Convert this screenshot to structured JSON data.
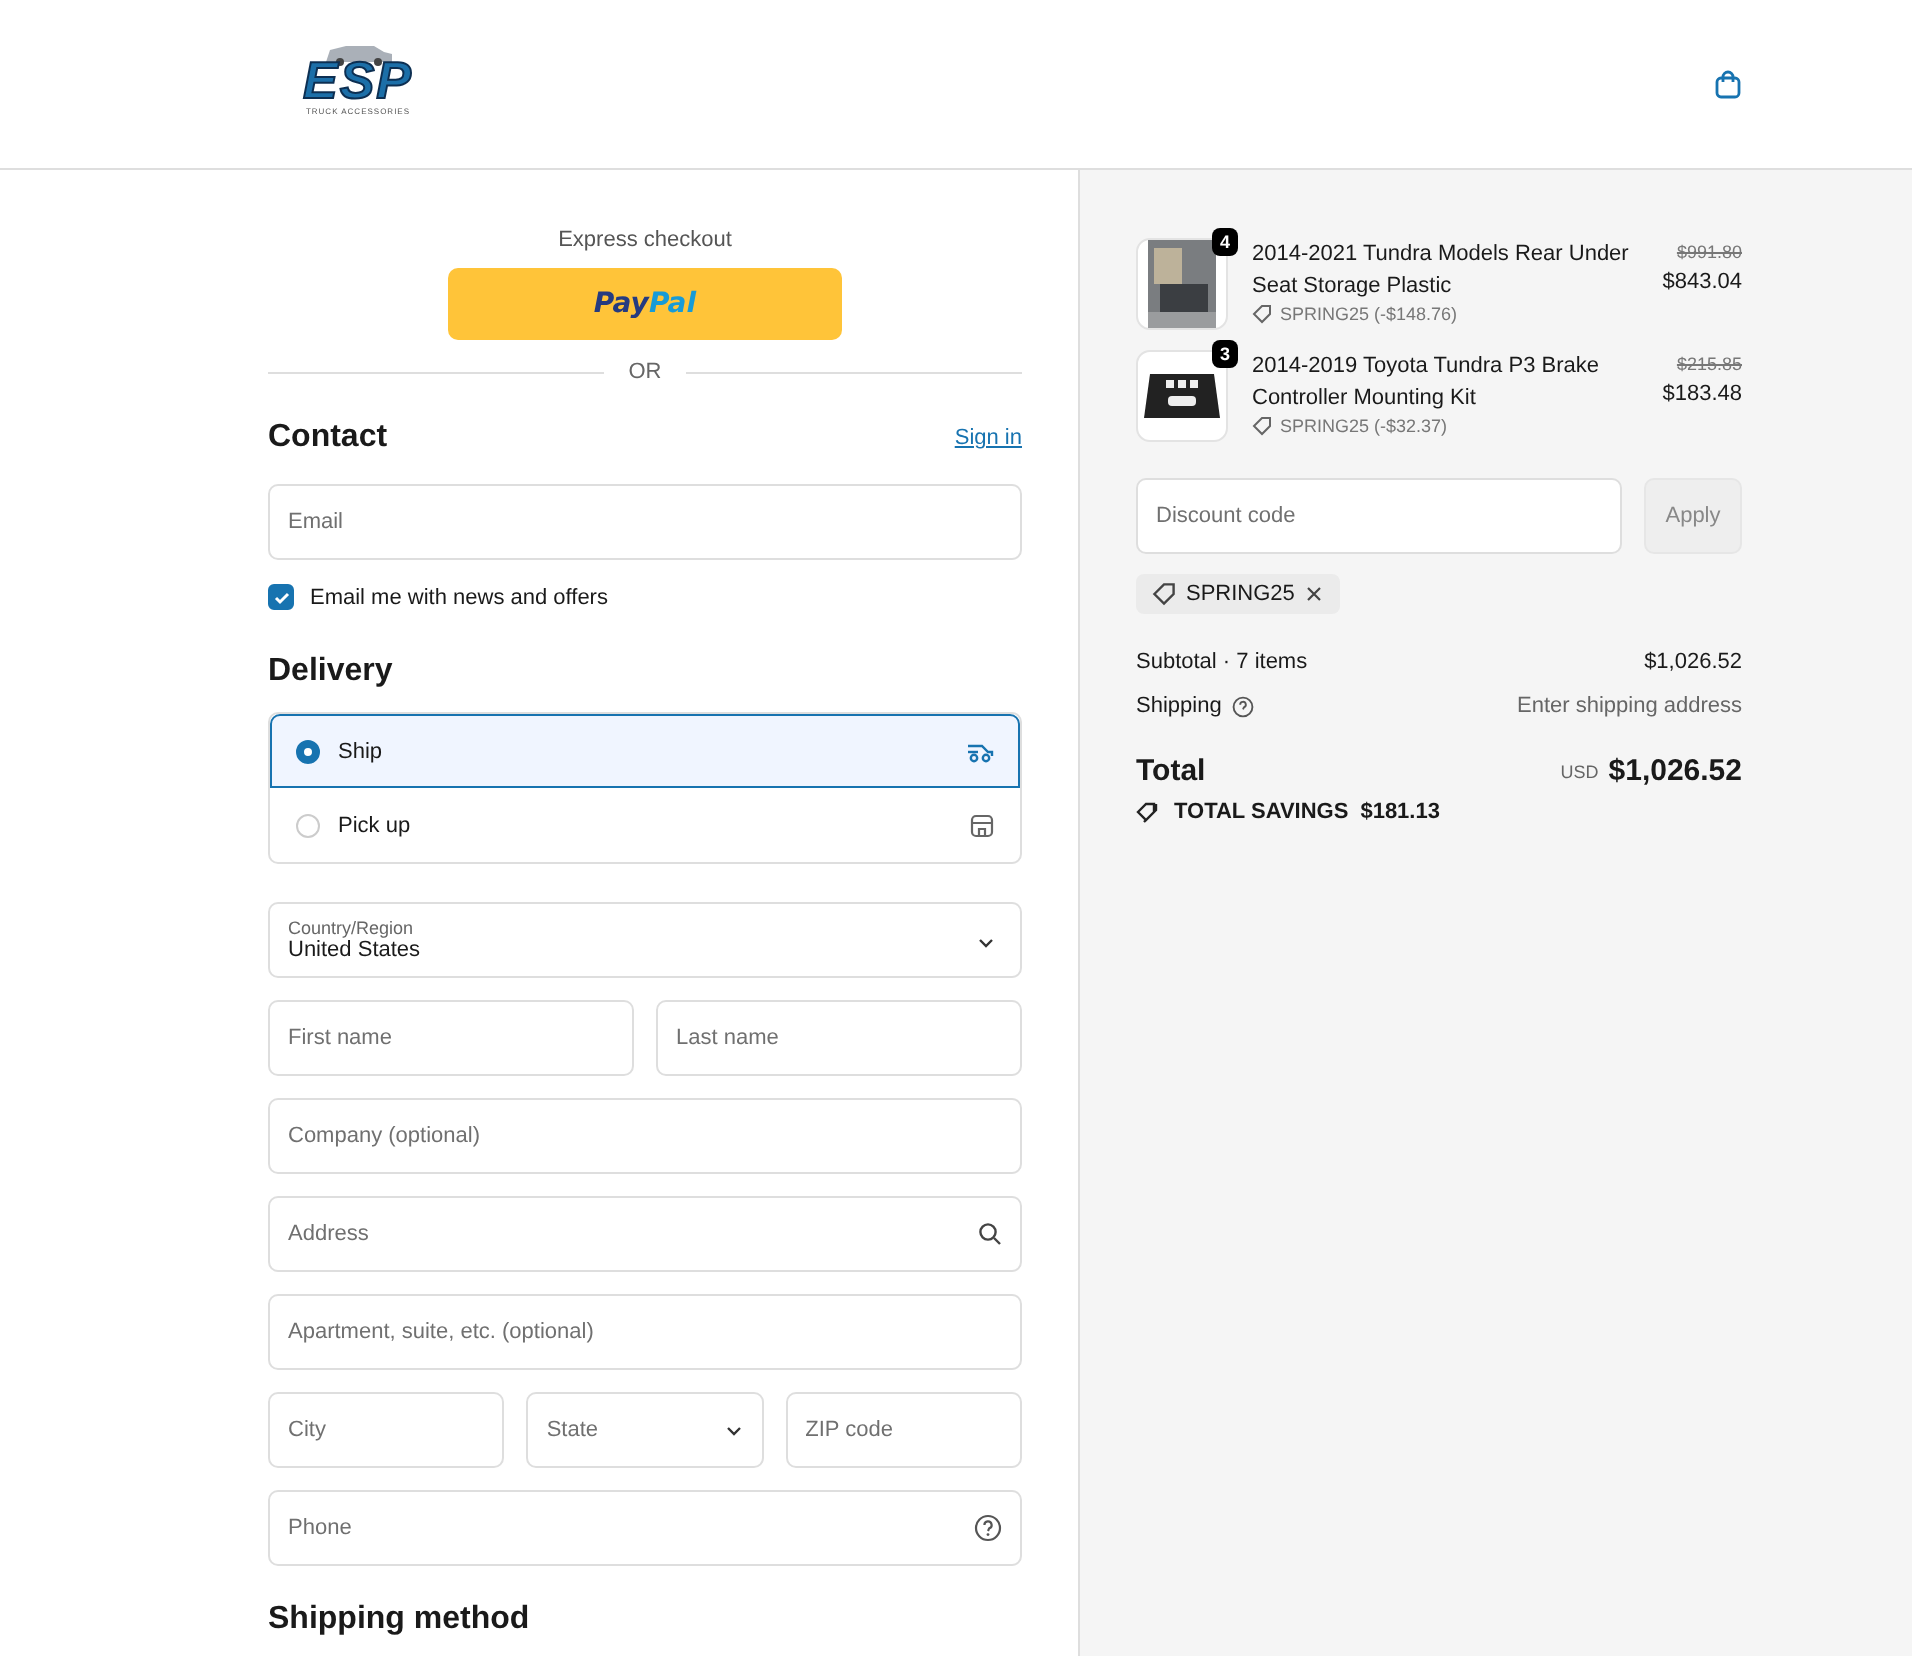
{
  "header": {
    "logo": {
      "text": "ESP",
      "subtitle": "TRUCK ACCESSORIES"
    }
  },
  "express": {
    "title": "Express checkout",
    "paypal": [
      "Pay",
      "Pal"
    ],
    "divider": "OR"
  },
  "contact": {
    "title": "Contact",
    "link": "Sign in",
    "email": {
      "placeholder": "Email"
    },
    "newsletter": {
      "label": "Email me with news and offers",
      "checked": true
    }
  },
  "delivery": {
    "title": "Delivery",
    "options": [
      {
        "label": "Ship",
        "selected": true,
        "kind": "ship"
      },
      {
        "label": "Pick up",
        "selected": false,
        "kind": "pickup"
      }
    ]
  },
  "address": {
    "country": {
      "label": "Country/Region",
      "value": "United States"
    },
    "rows": [
      [
        {
          "placeholder": "First name",
          "kind": "text"
        },
        {
          "placeholder": "Last name",
          "kind": "text"
        }
      ],
      [
        {
          "placeholder": "Company (optional)",
          "kind": "text"
        }
      ],
      [
        {
          "placeholder": "Address",
          "kind": "search"
        }
      ],
      [
        {
          "placeholder": "Apartment, suite, etc. (optional)",
          "kind": "text"
        }
      ],
      [
        {
          "placeholder": "City",
          "kind": "text"
        },
        {
          "placeholder": "State",
          "kind": "select"
        },
        {
          "placeholder": "ZIP code",
          "kind": "text"
        }
      ],
      [
        {
          "placeholder": "Phone",
          "kind": "help"
        }
      ]
    ]
  },
  "shipping_method": {
    "title": "Shipping method"
  },
  "summary": {
    "items": [
      {
        "quantity": "4",
        "name": "2014-2021 Tundra Models Rear Under Seat Storage Plastic",
        "discount": "SPRING25 (-$148.76)",
        "original_price": "$991.80",
        "price": "$843.04",
        "kind": "photo"
      },
      {
        "quantity": "3",
        "name": "2014-2019 Toyota Tundra P3 Brake Controller Mounting Kit",
        "discount": "SPRING25 (-$32.37)",
        "original_price": "$215.85",
        "price": "$183.48",
        "kind": "bracket"
      }
    ],
    "discount": {
      "placeholder": "Discount code",
      "button": "Apply"
    },
    "applied_code": "SPRING25",
    "subtotal": {
      "label": "Subtotal · 7 items",
      "value": "$1,026.52"
    },
    "shipping": {
      "label": "Shipping",
      "value": "Enter shipping address"
    },
    "total": {
      "label": "Total",
      "currency": "USD",
      "value": "$1,026.52"
    },
    "savings": {
      "label": "TOTAL SAVINGS",
      "value": "$181.13"
    }
  }
}
